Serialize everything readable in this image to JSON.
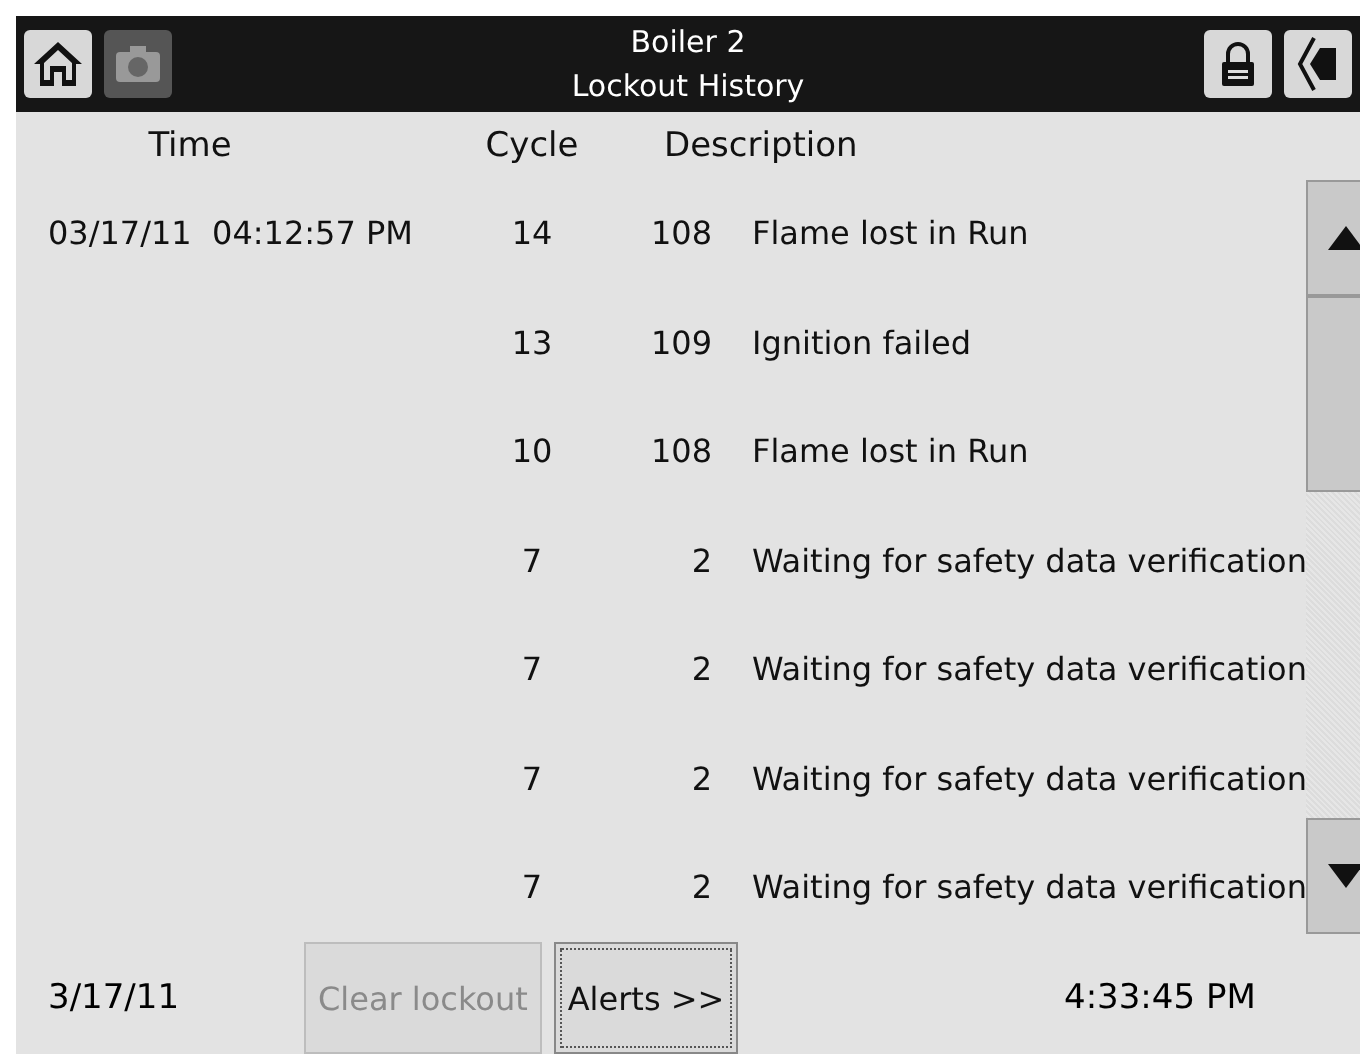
{
  "header": {
    "title": "Boiler 2",
    "subtitle": "Lockout History"
  },
  "columns": [
    "Time",
    "Cycle",
    "Description"
  ],
  "rows": [
    {
      "time": "03/17/11  04:12:57 PM",
      "cycle": "14",
      "code": "108",
      "description": "Flame lost in Run"
    },
    {
      "cycle": "13",
      "code": "109",
      "description": "Ignition failed"
    },
    {
      "cycle": "10",
      "code": "108",
      "description": "Flame lost in Run"
    },
    {
      "cycle": "7",
      "code": "2",
      "description": "Waiting for safety data verification"
    },
    {
      "cycle": "7",
      "code": "2",
      "description": "Waiting for safety data verification"
    },
    {
      "cycle": "7",
      "code": "2",
      "description": "Waiting for safety data verification"
    },
    {
      "cycle": "7",
      "code": "2",
      "description": "Waiting for safety data verification"
    }
  ],
  "footer": {
    "date": "3/17/11",
    "buttons": [
      {
        "label": "Clear lockout",
        "disabled": true
      },
      {
        "label": "Alerts >>",
        "disabled": false
      }
    ],
    "time": "4:33:45 PM"
  }
}
